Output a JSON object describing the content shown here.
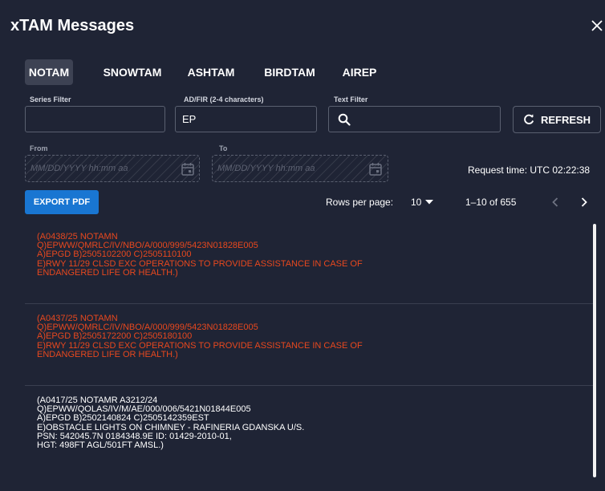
{
  "dialog": {
    "title": "xTAM Messages"
  },
  "tabs": [
    {
      "label": "NOTAM",
      "active": true
    },
    {
      "label": "SNOWTAM",
      "active": false
    },
    {
      "label": "ASHTAM",
      "active": false
    },
    {
      "label": "BIRDTAM",
      "active": false
    },
    {
      "label": "AIREP",
      "active": false
    }
  ],
  "filters": {
    "series": {
      "label": "Series Filter",
      "value": ""
    },
    "adfir": {
      "label": "AD/FIR (2-4 characters)",
      "value": "EP"
    },
    "text": {
      "label": "Text Filter",
      "value": ""
    }
  },
  "refresh_label": "REFRESH",
  "dates": {
    "from_label": "From",
    "to_label": "To",
    "placeholder": "MM/DD/YYYY hh:mm aa"
  },
  "request_time": "Request time: UTC 02:22:38",
  "export_label": "EXPORT PDF",
  "pagination": {
    "rows_label": "Rows per page:",
    "rows_value": "10",
    "range": "1–10 of 655"
  },
  "messages": [
    {
      "color": "#e8481e",
      "text": "(A0438/25 NOTAMN\nQ)EPWW/QMRLC/IV/NBO/A/000/999/5423N01828E005\nA)EPGD B)2505102200 C)2505110100\nE)RWY 11/29 CLSD EXC OPERATIONS TO PROVIDE ASSISTANCE IN CASE OF\nENDANGERED LIFE OR HEALTH.)"
    },
    {
      "color": "#e8481e",
      "text": "(A0437/25 NOTAMN\nQ)EPWW/QMRLC/IV/NBO/A/000/999/5423N01828E005\nA)EPGD B)2505172200 C)2505180100\nE)RWY 11/29 CLSD EXC OPERATIONS TO PROVIDE ASSISTANCE IN CASE OF\nENDANGERED LIFE OR HEALTH.)"
    },
    {
      "color": "#ffffff",
      "text": "(A0417/25 NOTAMR A3212/24\nQ)EPWW/QOLAS/IV/M/AE/000/006/5421N01844E005\nA)EPGD B)2502140824 C)2505142359EST\nE)OBSTACLE LIGHTS ON CHIMNEY - RAFINERIA GDANSKA U/S.\nPSN: 542045.7N 0184348.9E ID: 01429-2010-01,\nHGT: 498FT AGL/501FT AMSL.)"
    }
  ],
  "colors": {
    "background": "#1f2435",
    "accent": "#1976d2",
    "highlight_text": "#e8481e"
  }
}
